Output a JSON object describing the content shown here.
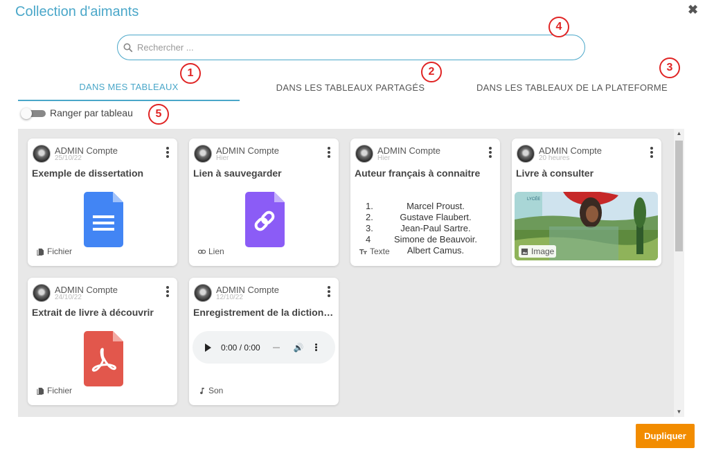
{
  "dialog": {
    "title": "Collection d'aimants",
    "close_symbol": "✖"
  },
  "search": {
    "placeholder": "Rechercher ...",
    "value": ""
  },
  "tabs": [
    {
      "label": "DANS MES TABLEAUX",
      "active": true
    },
    {
      "label": "DANS LES TABLEAUX PARTAGÉS",
      "active": false
    },
    {
      "label": "DANS LES TABLEAUX DE LA PLATEFORME",
      "active": false
    }
  ],
  "toggle": {
    "label": "Ranger par tableau",
    "checked": false
  },
  "callouts": [
    "1",
    "2",
    "3",
    "4",
    "5"
  ],
  "cards": [
    {
      "author": "ADMIN Compte",
      "date": "25/10/22",
      "title": "Exemple de dissertation",
      "type_label": "Fichier",
      "type_icon": "file-icon",
      "preview": "google-doc-icon"
    },
    {
      "author": "ADMIN Compte",
      "date": "Hier",
      "title": "Lien à sauvegarder",
      "type_label": "Lien",
      "type_icon": "link-icon",
      "preview": "link-doc-icon"
    },
    {
      "author": "ADMIN Compte",
      "date": "Hier",
      "title": "Auteur français à connaitre",
      "type_label": "Texte",
      "type_icon": "text-icon",
      "preview": "text-list",
      "list": [
        {
          "num": "1.",
          "text": "Marcel Proust."
        },
        {
          "num": "2.",
          "text": "Gustave Flaubert."
        },
        {
          "num": "3.",
          "text": "Jean-Paul Sartre."
        },
        {
          "num": "4",
          "text": "Simone de Beauvoir."
        },
        {
          "num": "",
          "text": "Albert Camus."
        }
      ]
    },
    {
      "author": "ADMIN Compte",
      "date": "20 heures",
      "title": "Livre à consulter",
      "type_label": "Image",
      "type_icon": "image-icon",
      "preview": "photo-thumbnail"
    },
    {
      "author": "ADMIN Compte",
      "date": "24/10/22",
      "title": "Extrait de livre à découvrir",
      "type_label": "Fichier",
      "type_icon": "file-icon",
      "preview": "pdf-icon"
    },
    {
      "author": "ADMIN Compte",
      "date": "12/10/22",
      "title": "Enregistrement de la diction…",
      "type_label": "Son",
      "type_icon": "music-note-icon",
      "preview": "audio-player",
      "audio_time": "0:00 / 0:00"
    }
  ],
  "footer": {
    "duplicate_label": "Dupliquer"
  },
  "colors": {
    "accent": "#4aa7c9",
    "callout": "#e02424",
    "button": "#f28c00",
    "panel_bg": "#e8e8e8",
    "gdoc_blue": "#4285f4",
    "link_purple": "#8b5cf6",
    "pdf_red": "#e2574c"
  }
}
